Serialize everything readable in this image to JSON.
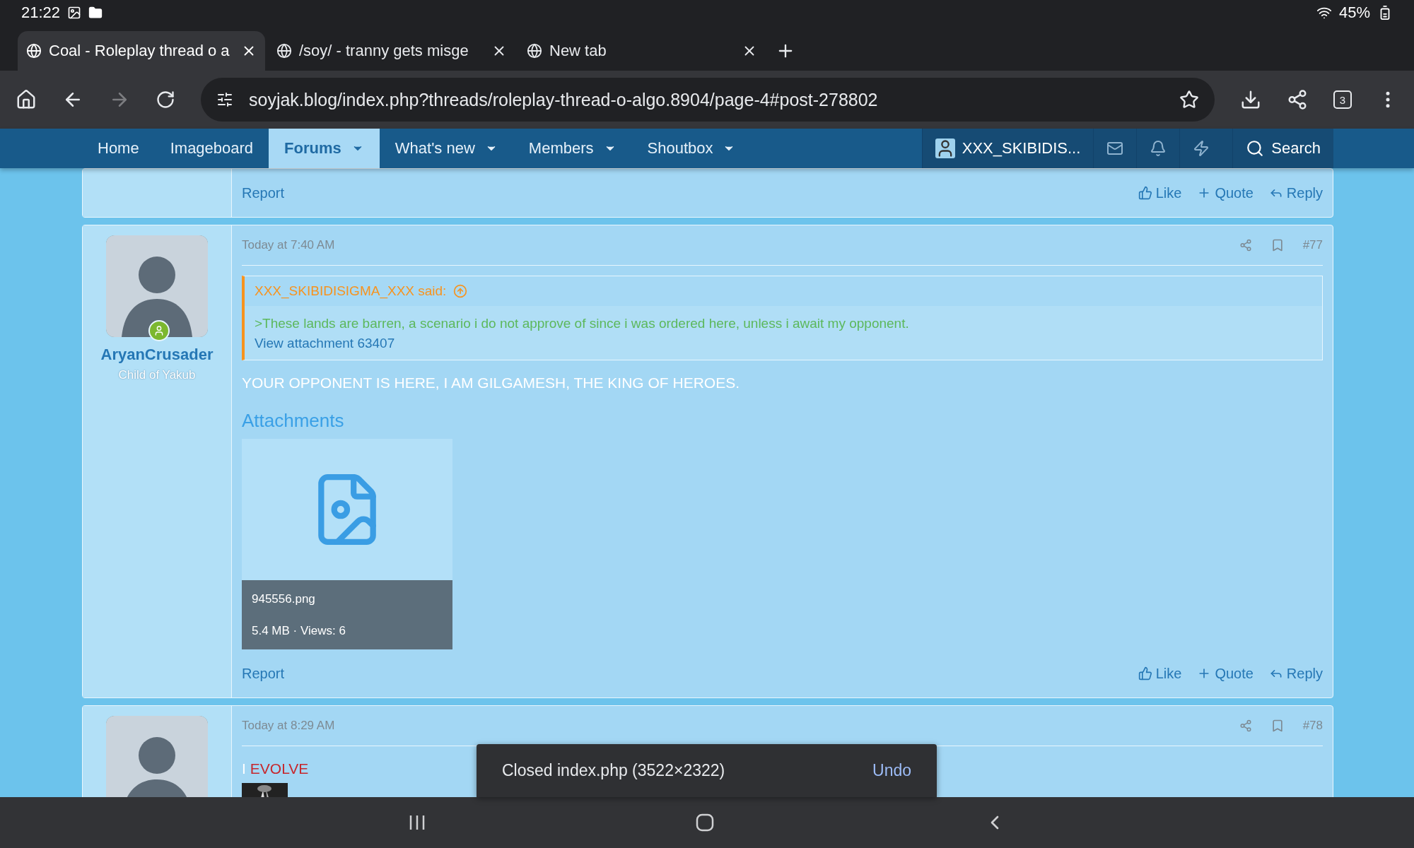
{
  "status_bar": {
    "time": "21:22",
    "battery": "45%"
  },
  "browser_tabs": [
    {
      "title": "Coal - Roleplay thread o a",
      "selected": true
    },
    {
      "title": "/soy/ - tranny gets misge",
      "selected": false
    },
    {
      "title": "New tab",
      "selected": false
    }
  ],
  "address_bar": {
    "url": "soyjak.blog/index.php?threads/roleplay-thread-o-algo.8904/page-4#post-278802",
    "tab_count": "3"
  },
  "nav": {
    "items": [
      {
        "label": "Home",
        "selected": false,
        "dropdown": false
      },
      {
        "label": "Imageboard",
        "selected": false,
        "dropdown": false
      },
      {
        "label": "Forums",
        "selected": true,
        "dropdown": true
      },
      {
        "label": "What's new",
        "selected": false,
        "dropdown": true
      },
      {
        "label": "Members",
        "selected": false,
        "dropdown": true
      },
      {
        "label": "Shoutbox",
        "selected": false,
        "dropdown": true
      }
    ],
    "user": "XXX_SKIBIDIS...",
    "search": "Search"
  },
  "posts": [
    {
      "report": "Report",
      "actions": [
        "Like",
        "Quote",
        "Reply"
      ]
    },
    {
      "username": "AryanCrusader",
      "user_title": "Child of Yakub",
      "online": true,
      "time": "Today at 7:40 AM",
      "number": "#77",
      "quote": {
        "author": "XXX_SKIBIDISIGMA_XXX said:",
        "text": ">These lands are barren, a scenario i do not approve of since i was ordered here, unless i await my opponent.",
        "link": "View attachment 63407"
      },
      "body": [
        {
          "text": "YOUR OPPONENT IS HERE, I AM GILGAMESH, THE KING OF HEROES.",
          "color": "#ffffff"
        }
      ],
      "attachments": {
        "heading": "Attachments",
        "items": [
          {
            "name": "945556.png",
            "meta": "5.4 MB · Views: 6"
          }
        ]
      },
      "report": "Report",
      "actions": [
        "Like",
        "Quote",
        "Reply"
      ]
    },
    {
      "time": "Today at 8:29 AM",
      "number": "#78",
      "body": [
        {
          "text": "I",
          "color": "#ffffff"
        },
        {
          "text": "EVOLVE",
          "color": "#c6282d"
        }
      ],
      "thumbnail": true
    }
  ],
  "toast": {
    "message": "Closed index.php (3522×2322)",
    "action": "Undo"
  }
}
